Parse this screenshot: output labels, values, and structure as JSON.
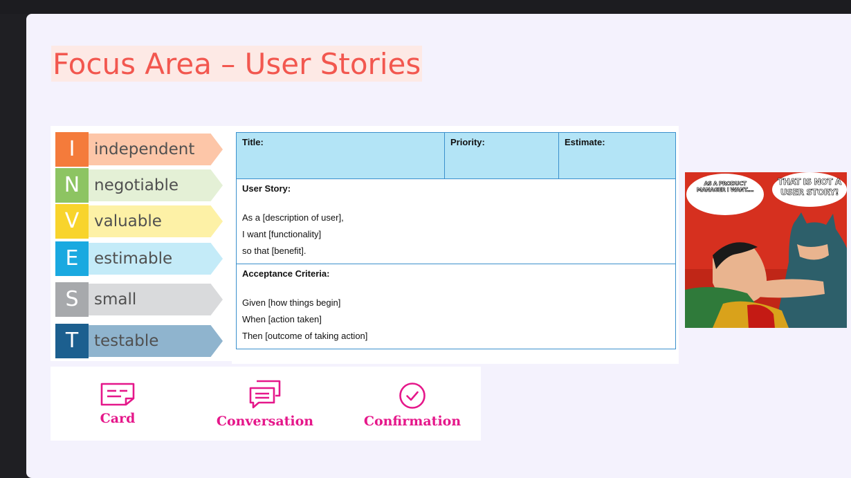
{
  "slide": {
    "title": "Focus Area – User Stories"
  },
  "invest": {
    "items": [
      {
        "letter": "I",
        "word": "independent",
        "letter_color": "#f47b3b",
        "arrow_color": "#fdc6a8"
      },
      {
        "letter": "N",
        "word": "negotiable",
        "letter_color": "#8dc462",
        "arrow_color": "#e4f0d6"
      },
      {
        "letter": "V",
        "word": "valuable",
        "letter_color": "#f8d42c",
        "arrow_color": "#fdf1a6"
      },
      {
        "letter": "E",
        "word": "estimable",
        "letter_color": "#1aa9e0",
        "arrow_color": "#c4ebf8"
      },
      {
        "letter": "S",
        "word": "small",
        "letter_color": "#a7a9ac",
        "arrow_color": "#d9dadc"
      },
      {
        "letter": "T",
        "word": "testable",
        "letter_color": "#1c5f8f",
        "arrow_color": "#8fb4ce"
      }
    ]
  },
  "story_card": {
    "title_label": "Title:",
    "priority_label": "Priority:",
    "estimate_label": "Estimate:",
    "user_story_label": "User Story:",
    "user_story_lines": [
      "As a [description of user],",
      "I want [functionality]",
      "so that [benefit]."
    ],
    "acceptance_label": "Acceptance Criteria:",
    "acceptance_lines": [
      "Given [how things begin]",
      "When [action taken]",
      "Then [outcome of taking action]"
    ]
  },
  "three_c": {
    "card": "Card",
    "conversation": "Conversation",
    "confirmation": "Confirmation",
    "accent_color": "#e5178a"
  },
  "meme": {
    "left_bubble": "AS A PRODUCT MANAGER I WANT....",
    "right_bubble": "THAT IS NOT A USER STORY!"
  }
}
